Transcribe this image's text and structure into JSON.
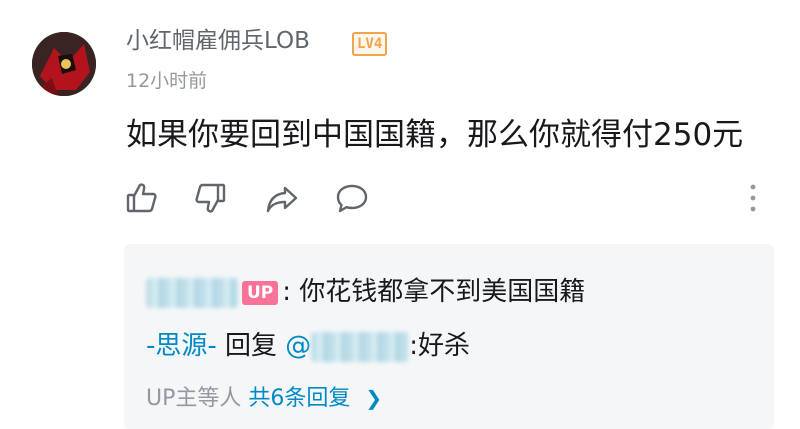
{
  "comment": {
    "username": "小红帽雇佣兵LOB",
    "level_badge": "LV4",
    "timestamp": "12小时前",
    "text": "如果你要回到中国国籍，那么你就得付250元"
  },
  "actions": {
    "icons": [
      "thumbs-up-icon",
      "thumbs-down-icon",
      "share-icon",
      "comment-icon",
      "more-vertical-icon"
    ]
  },
  "replies": {
    "reply1": {
      "up_badge": "UP",
      "text": ": 你花钱都拿不到美国国籍"
    },
    "reply2": {
      "author": "-思源-",
      "reply_word": " 回复 ",
      "mention_prefix": "@",
      "text": ":好杀"
    },
    "summary": {
      "prefix": "UP主等人 ",
      "link": "共6条回复",
      "chevron": "❯"
    }
  },
  "colors": {
    "accent_blue": "#008ac5",
    "up_pink": "#fb7299",
    "level_orange": "#f0a44c"
  }
}
